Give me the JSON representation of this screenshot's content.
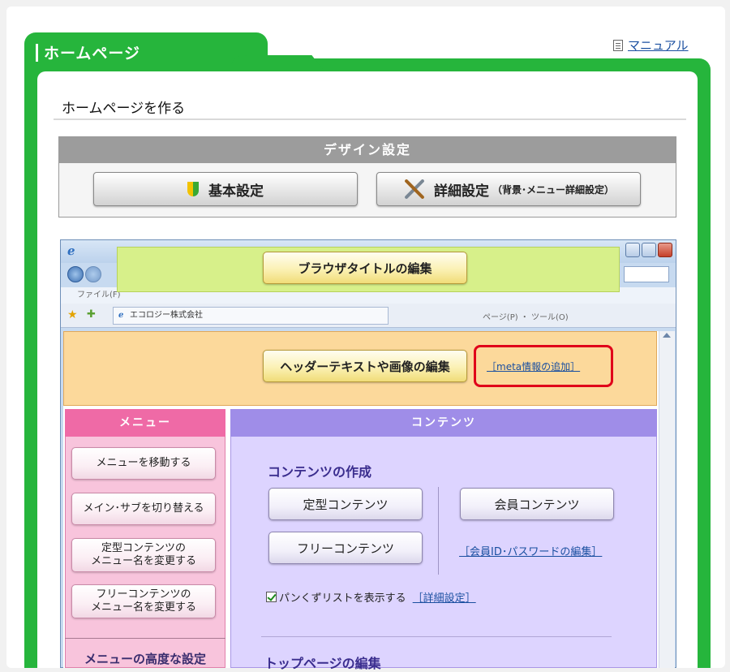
{
  "header": {
    "tab_title": "ホームページ",
    "manual_link": "マニュアル"
  },
  "page": {
    "title": "ホームページを作る"
  },
  "design": {
    "heading": "デザイン設定",
    "basic_label": "基本設定",
    "detail_label": "詳細設定",
    "detail_note": "（背景･メニュー詳細設定）"
  },
  "browser": {
    "menubar_text": "ファイル(F)",
    "fav_tab_text": "エコロジー株式会社",
    "fav_tools_text": "ページ(P) ・ ツール(O)",
    "browser_title_button": "ブラウザタイトルの編集"
  },
  "header_area": {
    "edit_button": "ヘッダーテキストや画像の編集",
    "meta_link": "［meta情報の追加］"
  },
  "menu": {
    "heading": "メニュー",
    "buttons": [
      {
        "label": "メニューを移動する"
      },
      {
        "label": "メイン･サブを切り替える"
      },
      {
        "label": "定型コンテンツの\nメニュー名を変更する"
      },
      {
        "label": "フリーコンテンツの\nメニュー名を変更する"
      }
    ],
    "advanced": "メニューの高度な設定"
  },
  "contents": {
    "heading": "コンテンツ",
    "create_heading": "コンテンツの作成",
    "fixed_button": "定型コンテンツ",
    "free_button": "フリーコンテンツ",
    "member_button": "会員コンテンツ",
    "member_link": "［会員ID･パスワードの編集］",
    "breadcrumb_label": "パンくずリストを表示する",
    "detail_link": "［詳細設定］",
    "top_edit": "トップページの編集"
  },
  "colors": {
    "green": "#26b53c",
    "orange_band": "#fcd99b",
    "pink_menu": "#ef6aa6",
    "purple_content": "#9f8de8",
    "highlight_red": "#e0001a"
  }
}
